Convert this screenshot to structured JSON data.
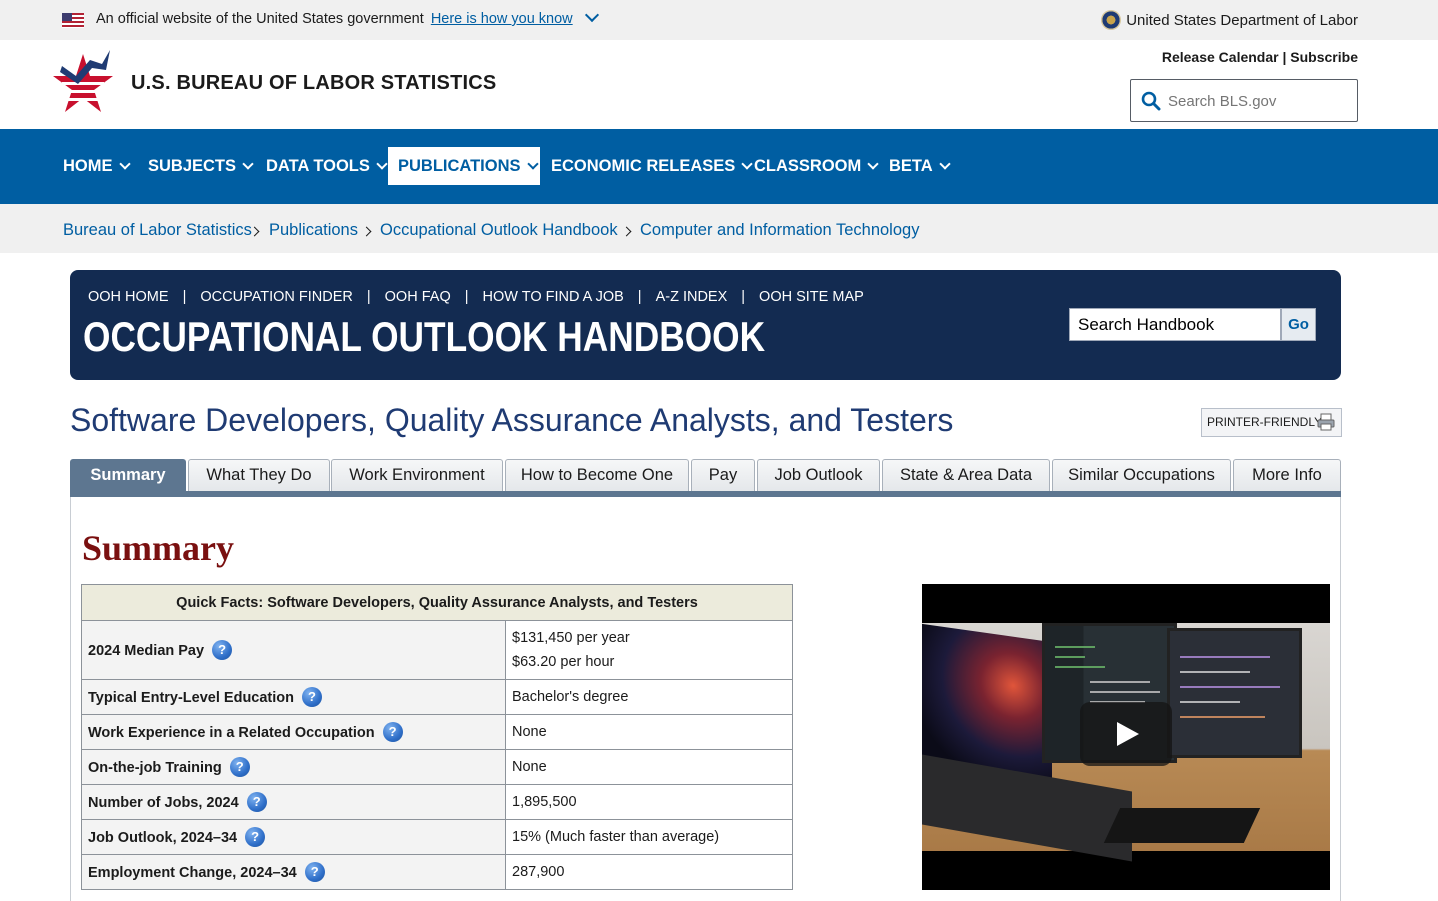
{
  "gov_banner": {
    "text": "An official website of the United States government",
    "link": "Here is how you know",
    "agency": "United States Department of Labor"
  },
  "header": {
    "site_title": "U.S. BUREAU OF LABOR STATISTICS",
    "release_calendar": "Release Calendar",
    "separator": " | ",
    "subscribe": "Subscribe",
    "search_placeholder": "Search BLS.gov"
  },
  "nav": {
    "items": [
      {
        "label": "HOME"
      },
      {
        "label": "SUBJECTS"
      },
      {
        "label": "DATA TOOLS"
      },
      {
        "label": "PUBLICATIONS",
        "active": true
      },
      {
        "label": "ECONOMIC RELEASES"
      },
      {
        "label": "CLASSROOM"
      },
      {
        "label": "BETA"
      }
    ]
  },
  "breadcrumb": [
    "Bureau of Labor Statistics",
    "Publications",
    "Occupational Outlook Handbook",
    "Computer and Information Technology"
  ],
  "ooh": {
    "links": [
      "OOH HOME",
      "OCCUPATION FINDER",
      "OOH FAQ",
      "HOW TO FIND A JOB",
      "A-Z INDEX",
      "OOH SITE MAP"
    ],
    "link_separator": "|",
    "title": "OCCUPATIONAL OUTLOOK HANDBOOK",
    "search_value": "Search Handbook",
    "go_label": "Go"
  },
  "page": {
    "title": "Software Developers, Quality Assurance Analysts, and Testers",
    "printer_label": "PRINTER-FRIENDLY"
  },
  "tabs": [
    {
      "label": "Summary",
      "active": true
    },
    {
      "label": "What They Do"
    },
    {
      "label": "Work Environment"
    },
    {
      "label": "How to Become One"
    },
    {
      "label": "Pay"
    },
    {
      "label": "Job Outlook"
    },
    {
      "label": "State & Area Data"
    },
    {
      "label": "Similar Occupations"
    },
    {
      "label": "More Info"
    }
  ],
  "summary": {
    "heading": "Summary",
    "quick_facts": {
      "caption": "Quick Facts: Software Developers, Quality Assurance Analysts, and Testers",
      "help_glyph": "?",
      "rows": [
        {
          "label": "2024 Median Pay",
          "value": "$131,450 per year",
          "value2": "$63.20 per hour"
        },
        {
          "label": "Typical Entry-Level Education",
          "value": "Bachelor's degree"
        },
        {
          "label": "Work Experience in a Related Occupation",
          "value": "None"
        },
        {
          "label": "On-the-job Training",
          "value": "None"
        },
        {
          "label": "Number of Jobs, 2024",
          "value": "1,895,500"
        },
        {
          "label": "Job Outlook, 2024–34",
          "value": "15% (Much faster than average)"
        },
        {
          "label": "Employment Change, 2024–34",
          "value": "287,900"
        }
      ]
    }
  },
  "colors": {
    "nav_blue": "#005ea2",
    "ooh_navy": "#132b51",
    "title_blue": "#1f3b73",
    "summary_red": "#7a1010",
    "tab_active": "#5d7690"
  }
}
